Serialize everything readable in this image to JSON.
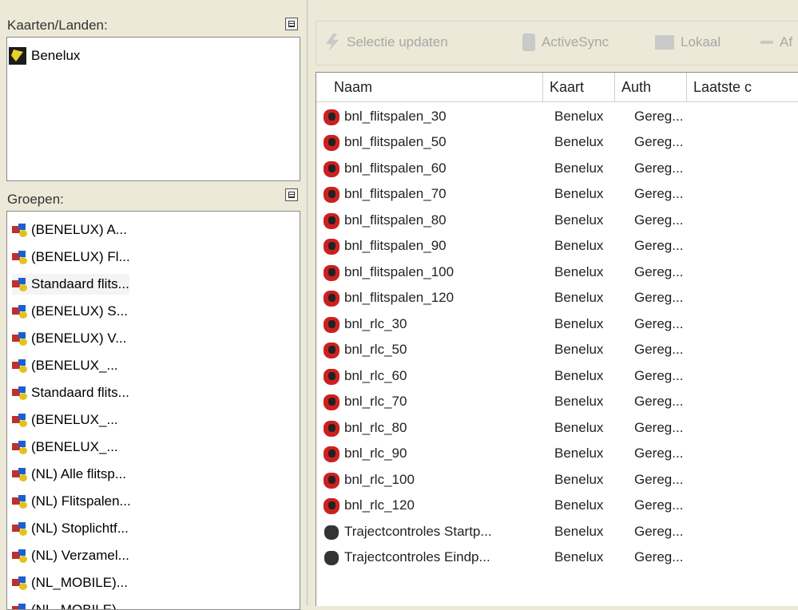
{
  "left": {
    "kaarten_label": "Kaarten/Landen:",
    "kaarten_items": [
      "Benelux"
    ],
    "groepen_label": "Groepen:",
    "groepen_items": [
      "(BENELUX) A...",
      "(BENELUX) Fl...",
      "Standaard flits...",
      "(BENELUX) S...",
      "(BENELUX) V...",
      "(BENELUX_...",
      "Standaard flits...",
      "(BENELUX_...",
      "(BENELUX_...",
      "(NL) Alle flitsp...",
      "(NL) Flitspalen...",
      "(NL) Stoplichtf...",
      "(NL) Verzamel...",
      "(NL_MOBILE)...",
      "(NL_MOBILE)..."
    ]
  },
  "toolbar": {
    "items": [
      {
        "label": "Selectie updaten",
        "icon": "lightning-icon"
      },
      {
        "label": "ActiveSync",
        "icon": "pda-icon"
      },
      {
        "label": "Lokaal",
        "icon": "folder-icon"
      },
      {
        "label": "Af",
        "icon": "minus-icon"
      }
    ]
  },
  "table": {
    "columns": [
      "Naam",
      "Kaart",
      "Auth",
      "Laatste c"
    ],
    "rows": [
      {
        "naam": "bnl_flitspalen_30",
        "kaart": "Benelux",
        "auth": "Gereg...",
        "icon": "red-hand-icon"
      },
      {
        "naam": "bnl_flitspalen_50",
        "kaart": "Benelux",
        "auth": "Gereg...",
        "icon": "red-hand-icon"
      },
      {
        "naam": "bnl_flitspalen_60",
        "kaart": "Benelux",
        "auth": "Gereg...",
        "icon": "red-hand-icon"
      },
      {
        "naam": "bnl_flitspalen_70",
        "kaart": "Benelux",
        "auth": "Gereg...",
        "icon": "red-hand-icon"
      },
      {
        "naam": "bnl_flitspalen_80",
        "kaart": "Benelux",
        "auth": "Gereg...",
        "icon": "red-hand-icon"
      },
      {
        "naam": "bnl_flitspalen_90",
        "kaart": "Benelux",
        "auth": "Gereg...",
        "icon": "red-hand-icon"
      },
      {
        "naam": "bnl_flitspalen_100",
        "kaart": "Benelux",
        "auth": "Gereg...",
        "icon": "red-hand-icon"
      },
      {
        "naam": "bnl_flitspalen_120",
        "kaart": "Benelux",
        "auth": "Gereg...",
        "icon": "red-hand-icon"
      },
      {
        "naam": "bnl_rlc_30",
        "kaart": "Benelux",
        "auth": "Gereg...",
        "icon": "red-hand-icon"
      },
      {
        "naam": "bnl_rlc_50",
        "kaart": "Benelux",
        "auth": "Gereg...",
        "icon": "red-hand-icon"
      },
      {
        "naam": "bnl_rlc_60",
        "kaart": "Benelux",
        "auth": "Gereg...",
        "icon": "red-hand-icon"
      },
      {
        "naam": "bnl_rlc_70",
        "kaart": "Benelux",
        "auth": "Gereg...",
        "icon": "red-hand-icon"
      },
      {
        "naam": "bnl_rlc_80",
        "kaart": "Benelux",
        "auth": "Gereg...",
        "icon": "red-hand-icon"
      },
      {
        "naam": "bnl_rlc_90",
        "kaart": "Benelux",
        "auth": "Gereg...",
        "icon": "red-hand-icon"
      },
      {
        "naam": "bnl_rlc_100",
        "kaart": "Benelux",
        "auth": "Gereg...",
        "icon": "red-hand-icon"
      },
      {
        "naam": "bnl_rlc_120",
        "kaart": "Benelux",
        "auth": "Gereg...",
        "icon": "red-hand-icon"
      },
      {
        "naam": "Trajectcontroles Startp...",
        "kaart": "Benelux",
        "auth": "Gereg...",
        "icon": "dark-hand-icon"
      },
      {
        "naam": "Trajectcontroles Eindp...",
        "kaart": "Benelux",
        "auth": "Gereg...",
        "icon": "dark-hand-icon"
      }
    ]
  }
}
